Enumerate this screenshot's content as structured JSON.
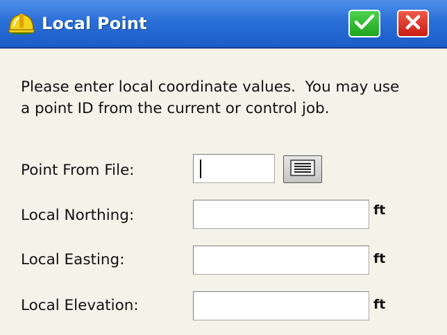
{
  "window": {
    "title": "Local Point",
    "app_icon": "hardhat-icon",
    "ok_icon": "checkmark-icon",
    "close_icon": "close-icon"
  },
  "instructions": {
    "line1": "Please enter local coordinate values.  You may use",
    "line2": "a point ID from the current or control job."
  },
  "form": {
    "point_from_file": {
      "label": "Point From File:",
      "value": "",
      "picker_icon": "list-icon"
    },
    "local_northing": {
      "label": "Local Northing:",
      "value": "",
      "unit": "ft"
    },
    "local_easting": {
      "label": "Local Easting:",
      "value": "",
      "unit": "ft"
    },
    "local_elevation": {
      "label": "Local Elevation:",
      "value": "",
      "unit": "ft"
    }
  },
  "colors": {
    "titlebar": "#2a6fd8",
    "ok": "#1fa41f",
    "close": "#c81d12",
    "background": "#f4f3ea"
  }
}
